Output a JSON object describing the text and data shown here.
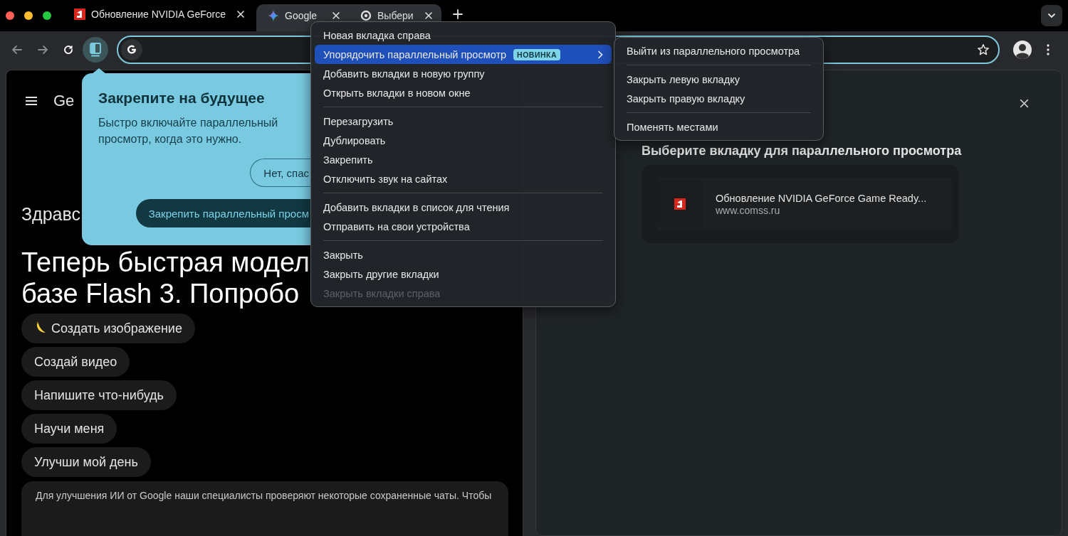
{
  "tabs": [
    {
      "title": "Обновление NVIDIA GeForce",
      "kind": "site",
      "selected": false
    },
    {
      "title": "Google",
      "kind": "sparkle",
      "selected": true
    },
    {
      "title": "Выбери",
      "kind": "ring",
      "selected": true
    }
  ],
  "toolbar": {
    "back_disabled": true,
    "forward_disabled": true,
    "split_active": true
  },
  "popover": {
    "title": "Закрепите на будущее",
    "body": "Быстро включайте параллельный просмотр, когда это нужно.",
    "buttons": [
      {
        "label": "Нет, спас",
        "kind": "outline"
      },
      {
        "label": "Закрепить параллельный просм",
        "kind": "filled"
      }
    ]
  },
  "context_menu": {
    "groups": [
      [
        {
          "label": "Новая вкладка справа",
          "highlighted": false,
          "disabled": false,
          "has_submenu": false
        },
        {
          "label": "Упорядочить параллельный просмотр",
          "badge": "НОВИНКА",
          "highlighted": true,
          "disabled": false,
          "has_submenu": true
        },
        {
          "label": "Добавить вкладки в новую группу",
          "highlighted": false,
          "disabled": false,
          "has_submenu": false
        },
        {
          "label": "Открыть вкладки в новом окне",
          "highlighted": false,
          "disabled": false,
          "has_submenu": false
        }
      ],
      [
        {
          "label": "Перезагрузить",
          "highlighted": false,
          "disabled": false,
          "has_submenu": false
        },
        {
          "label": "Дублировать",
          "highlighted": false,
          "disabled": false,
          "has_submenu": false
        },
        {
          "label": "Закрепить",
          "highlighted": false,
          "disabled": false,
          "has_submenu": false
        },
        {
          "label": "Отключить звук на сайтах",
          "highlighted": false,
          "disabled": false,
          "has_submenu": false
        }
      ],
      [
        {
          "label": "Добавить вкладки в список для чтения",
          "highlighted": false,
          "disabled": false,
          "has_submenu": false
        },
        {
          "label": "Отправить на свои устройства",
          "highlighted": false,
          "disabled": false,
          "has_submenu": false
        }
      ],
      [
        {
          "label": "Закрыть",
          "highlighted": false,
          "disabled": false,
          "has_submenu": false
        },
        {
          "label": "Закрыть другие вкладки",
          "highlighted": false,
          "disabled": false,
          "has_submenu": false
        },
        {
          "label": "Закрыть вкладки справа",
          "highlighted": false,
          "disabled": true,
          "has_submenu": false
        }
      ]
    ]
  },
  "submenu": {
    "groups": [
      [
        {
          "label": "Выйти из параллельного просмотра",
          "highlighted": false,
          "disabled": false,
          "has_submenu": false
        }
      ],
      [
        {
          "label": "Закрыть левую вкладку",
          "highlighted": false,
          "disabled": false,
          "has_submenu": false
        },
        {
          "label": "Закрыть правую вкладку",
          "highlighted": false,
          "disabled": false,
          "has_submenu": false
        }
      ],
      [
        {
          "label": "Поменять местами",
          "highlighted": false,
          "disabled": false,
          "has_submenu": false
        }
      ]
    ]
  },
  "gemini": {
    "logo": "Ge",
    "greeting": "Здравс",
    "headline": [
      "Теперь быстрая модел",
      "базе Flash 3. Попробо"
    ],
    "chips": [
      {
        "label": "Создать изображение",
        "kind": "icon"
      },
      {
        "label": "Создай видео",
        "kind": "plain"
      },
      {
        "label": "Напишите что-нибудь",
        "kind": "plain"
      },
      {
        "label": "Научи меня",
        "kind": "plain"
      },
      {
        "label": "Улучши мой день",
        "kind": "plain"
      }
    ],
    "notice": "Для улучшения ИИ от Google наши специалисты проверяют некоторые сохраненные чаты. Чтобы"
  },
  "split_panel": {
    "title": "Выберите вкладку для параллельного просмотра",
    "tab": {
      "title": "Обновление NVIDIA GeForce Game Ready...",
      "url": "www.comss.ru"
    }
  }
}
